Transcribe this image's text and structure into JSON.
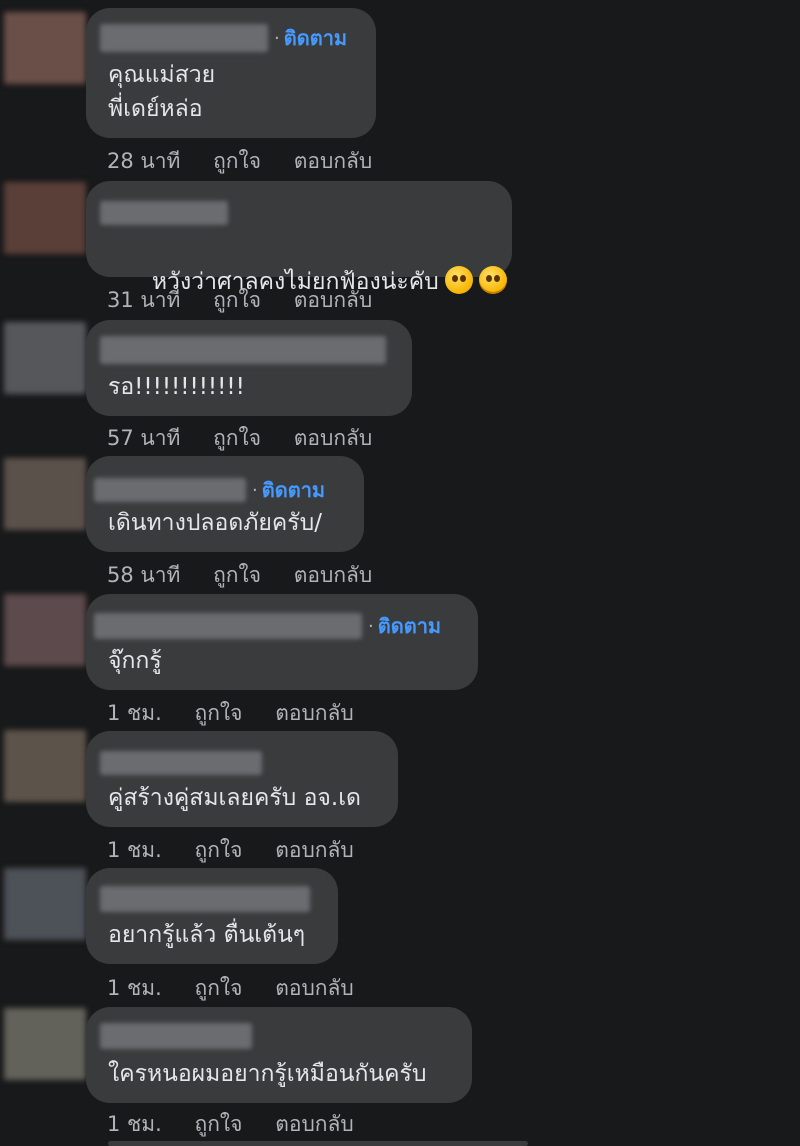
{
  "comments": [
    {
      "text": "คุณแม่สวย\nพี่เดย์หล่อ",
      "follow": "ติดตาม",
      "time": "28 นาที",
      "like": "ถูกใจ",
      "reply": "ตอบกลับ",
      "avatar_color": "#6a4f48"
    },
    {
      "text": "หวังว่าศาลคงไม่ยกฟ้องน่ะคับ",
      "follow": "",
      "time": "31 นาที",
      "like": "ถูกใจ",
      "reply": "ตอบกลับ",
      "avatar_color": "#5a3f38",
      "emoji": [
        "pleading-face-emoji",
        "sad-face-emoji"
      ]
    },
    {
      "text": "รอ!!!!!!!!!!!!",
      "follow": "",
      "time": "57 นาที",
      "like": "ถูกใจ",
      "reply": "ตอบกลับ",
      "avatar_color": "#55575b"
    },
    {
      "text": "เดินทางปลอดภัยครับ/",
      "follow": "ติดตาม",
      "time": "58 นาที",
      "like": "ถูกใจ",
      "reply": "ตอบกลับ",
      "avatar_color": "#5b514b"
    },
    {
      "text": "จุ๊กกรู้",
      "follow": "ติดตาม",
      "time": "1 ชม.",
      "like": "ถูกใจ",
      "reply": "ตอบกลับ",
      "avatar_color": "#5c4a4c"
    },
    {
      "text": "คู่สร้างคู่สมเลยครับ อจ.เด",
      "follow": "",
      "time": "1 ชม.",
      "like": "ถูกใจ",
      "reply": "ตอบกลับ",
      "avatar_color": "#5c544a"
    },
    {
      "text": "อยากรู้แล้ว ตื่นเต้นๆ",
      "follow": "",
      "time": "1 ชม.",
      "like": "ถูกใจ",
      "reply": "ตอบกลับ",
      "avatar_color": "#4d5158"
    },
    {
      "text": "ใครหนอผมอยากรู้เหมือนกันครับ",
      "follow": "",
      "time": "1 ชม.",
      "like": "ถูกใจ",
      "reply": "ตอบกลับ",
      "avatar_color": "#62625a"
    }
  ]
}
